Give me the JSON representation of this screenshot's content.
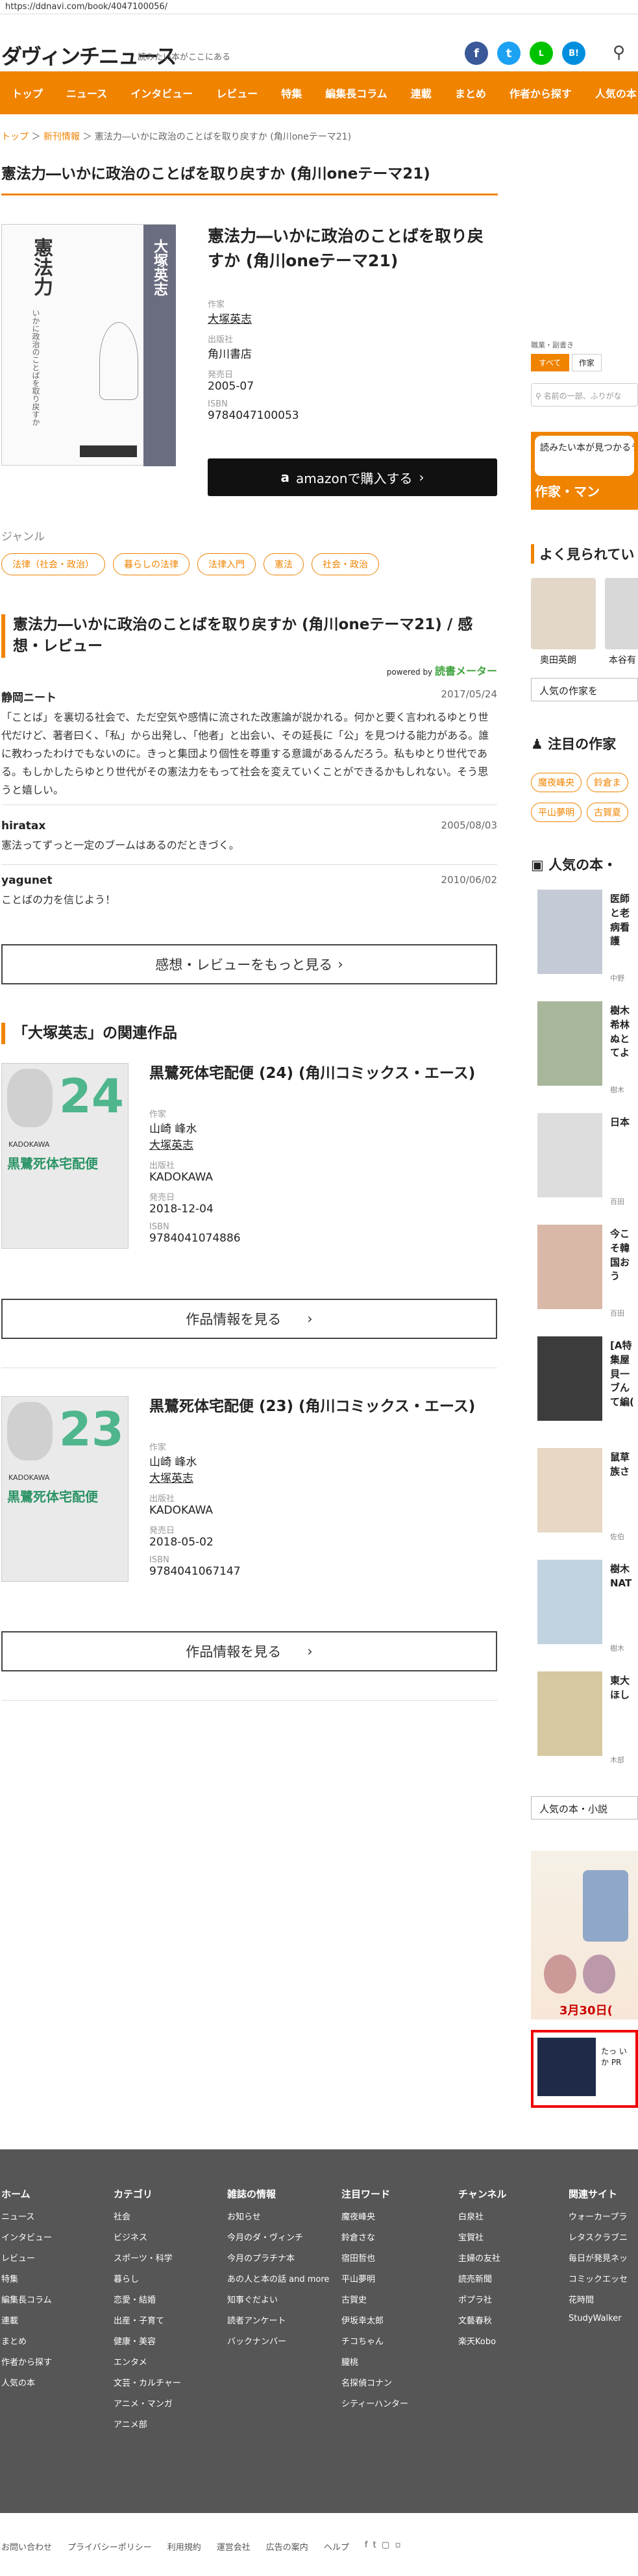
{
  "browser": {
    "url": "https://ddnavi.com/book/4047100056/"
  },
  "site": {
    "logo": "ダヴィンチニュース",
    "tagline": "読みたい本がここにある",
    "social": [
      "f",
      "t",
      "L",
      "B!"
    ],
    "colors": {
      "accent": "#f08300",
      "facebook": "#3b5998",
      "twitter": "#1da1f2",
      "line": "#00c300",
      "hatena": "#008fde"
    }
  },
  "nav": [
    "トップ",
    "ニュース",
    "インタビュー",
    "レビュー",
    "特集",
    "編集長コラム",
    "連載",
    "まとめ",
    "作者から探す",
    "人気の本"
  ],
  "breadcrumb": {
    "home": "トップ",
    "section": "新刊情報",
    "current": "憲法力―いかに政治のことばを取り戻すか (角川oneテーマ21)"
  },
  "page_title": "憲法力―いかに政治のことばを取り戻すか (角川oneテーマ21)",
  "book": {
    "title": "憲法力―いかに政治のことばを取り戻すか (角川oneテーマ21)",
    "cover_title": "憲法力",
    "cover_author": "大塚英志",
    "cover_sub": "いかに政治のことばを取り戻すか",
    "author_label": "作家",
    "author": "大塚英志",
    "publisher_label": "出版社",
    "publisher": "角川書店",
    "date_label": "発売日",
    "date": "2005-07",
    "isbn_label": "ISBN",
    "isbn": "9784047100053",
    "amazon_label": "amazonで購入する"
  },
  "genre": {
    "label": "ジャンル",
    "tags": [
      "法律（社会・政治）",
      "暮らしの法律",
      "法律入門",
      "憲法",
      "社会・政治"
    ]
  },
  "reviews": {
    "heading": "憲法力―いかに政治のことばを取り戻すか (角川oneテーマ21) / 感想・レビュー",
    "powered": "powered by",
    "brand": "読書メーター",
    "items": [
      {
        "user": "静岡ニート",
        "date": "2017/05/24",
        "text": "「ことば」を裏切る社会で、ただ空気や感情に流された改憲論が説かれる。何かと要く言われるゆとり世代だけど、著者曰く、「私」から出発し、「他者」と出会い、その延長に「公」を見つける能力がある。誰に教わったわけでもないのに。きっと集団より個性を尊重する意識があるんだろう。私もゆとり世代である。もしかしたらゆとり世代がその憲法力をもって社会を変えていくことができるかもしれない。そう思うと嬉しい。"
      },
      {
        "user": "hiratax",
        "date": "2005/08/03",
        "text": "憲法ってずっと一定のブームはあるのだときづく。"
      },
      {
        "user": "yagunet",
        "date": "2010/06/02",
        "text": "ことばの力を信じよう！"
      }
    ],
    "more": "感想・レビューをもっと見る"
  },
  "related": {
    "heading": "「大塚英志」の関連作品",
    "items": [
      {
        "title": "黒鷺死体宅配便 (24) (角川コミックス・エース)",
        "cover_num": "24",
        "author_label": "作家",
        "author": "山崎 峰水",
        "author2": "大塚英志",
        "publisher_label": "出版社",
        "publisher": "KADOKAWA",
        "date_label": "発売日",
        "date": "2018-12-04",
        "isbn_label": "ISBN",
        "isbn": "9784041074886",
        "button": "作品情報を見る"
      },
      {
        "title": "黒鷺死体宅配便 (23) (角川コミックス・エース)",
        "cover_num": "23",
        "author_label": "作家",
        "author": "山崎 峰水",
        "author2": "大塚英志",
        "publisher_label": "出版社",
        "publisher": "KADOKAWA",
        "date_label": "発売日",
        "date": "2018-05-02",
        "isbn_label": "ISBN",
        "isbn": "9784041067147",
        "button": "作品情報を見る"
      }
    ],
    "cover_title": "黒鷺死体宅配便",
    "cover_publisher": "KADOKAWA"
  },
  "sidebar": {
    "search_label": "職業・副書き",
    "tabs": [
      "すべて",
      "作家"
    ],
    "search_placeholder": "名前の一部、ふりがな",
    "banner": "読みたい本が見つかるラ",
    "banner_sub": "作家・マン",
    "popular_authors_heading": "よく見られてい",
    "authors": [
      "奥田英朗",
      "本谷有"
    ],
    "authors_more": "人気の作家を",
    "attention_heading": "注目の作家",
    "attention_tags": [
      "魔夜峰央",
      "鈴倉ま",
      "平山夢明",
      "古賀夏"
    ],
    "popular_books_heading": "人気の本・",
    "books": [
      {
        "title": "医師と老病看護",
        "author": "中野"
      },
      {
        "title": "樹木希林ぬとてよ",
        "author": "樹木"
      },
      {
        "title": "日本",
        "author": "百田"
      },
      {
        "title": "今こそ韓国おう",
        "author": "百田"
      },
      {
        "title": "[A特集屋貝一ブんて編(",
        "author": ""
      },
      {
        "title": "鼠草族さ",
        "author": "佐伯"
      },
      {
        "title": "樹木NAT",
        "author": "樹木"
      },
      {
        "title": "東大ほし",
        "author": "木部"
      }
    ],
    "books_more": "人気の本・小説",
    "ad_date": "3月30日(",
    "ad2": "たっ いか PR"
  },
  "footer": {
    "cols": [
      {
        "h": "ホーム",
        "items": [
          "ニュース",
          "インタビュー",
          "レビュー",
          "特集",
          "編集長コラム",
          "連載",
          "まとめ",
          "作者から探す",
          "人気の本"
        ]
      },
      {
        "h": "カテゴリ",
        "items": [
          "社会",
          "ビジネス",
          "スポーツ・科学",
          "暮らし",
          "恋愛・結婚",
          "出産・子育て",
          "健康・美容",
          "エンタメ",
          "文芸・カルチャー",
          "アニメ・マンガ",
          "アニメ部"
        ]
      },
      {
        "h": "雑誌の情報",
        "items": [
          "お知らせ",
          "今月のダ・ヴィンチ",
          "今月のプラチナ本",
          "あの人と本の話 and more",
          "知事ぐだよい",
          "読者アンケート",
          "バックナンバー"
        ]
      },
      {
        "h": "注目ワード",
        "items": [
          "魔夜峰央",
          "鈴倉さな",
          "宿田哲也",
          "平山夢明",
          "古賀史",
          "伊坂幸太郎",
          "チコちゃん",
          "朧桃",
          "名探偵コナン",
          "シティーハンター"
        ]
      },
      {
        "h": "チャンネル",
        "items": [
          "白泉社",
          "宝賀社",
          "主婦の友社",
          "読売新聞",
          "ポプラ社",
          "文藝春秋",
          "楽天Kobo"
        ]
      },
      {
        "h": "関連サイト",
        "items": [
          "ウォーカープラ",
          "レタスクラブニ",
          "毎日が発見ネッ",
          "コミックエッセ",
          "花時間",
          "StudyWalker"
        ]
      }
    ]
  },
  "bottom_links": [
    "お問い合わせ",
    "プライバシーポリシー",
    "利用規約",
    "運営会社",
    "広告の案内",
    "ヘルプ"
  ]
}
